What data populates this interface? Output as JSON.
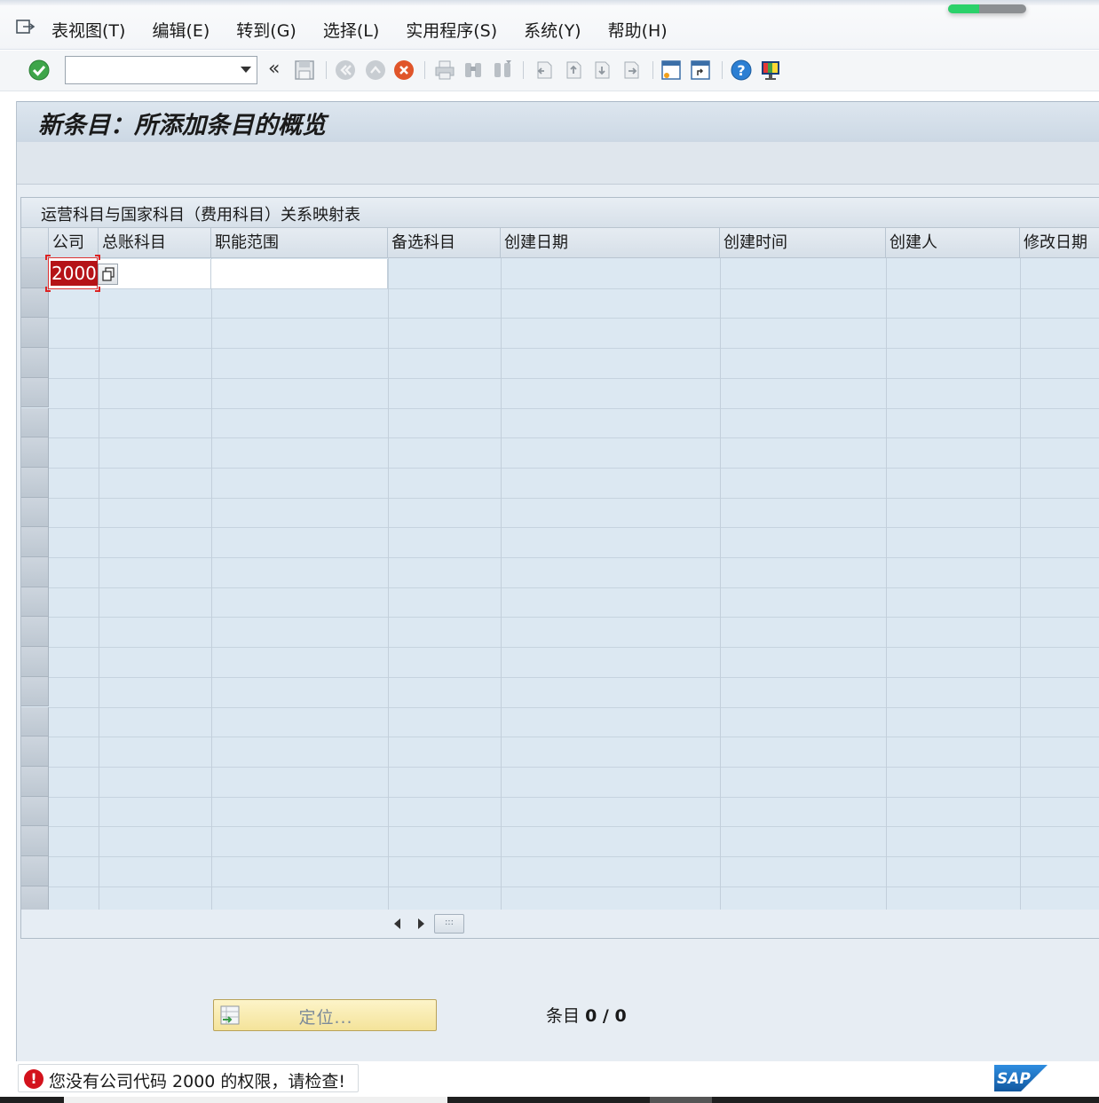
{
  "menu": {
    "items": [
      "表视图(T)",
      "编辑(E)",
      "转到(G)",
      "选择(L)",
      "实用程序(S)",
      "系统(Y)",
      "帮助(H)"
    ]
  },
  "progress": {
    "fraction": 0.4
  },
  "toolbar": {
    "command_value": "",
    "collapse_label": "«",
    "icons": [
      "check-icon",
      "save-icon",
      "back-icon",
      "exit-icon",
      "cancel-icon",
      "print-icon",
      "find-icon",
      "find-next-icon",
      "first-page-icon",
      "previous-page-icon",
      "next-page-icon",
      "last-page-icon",
      "create-session-icon",
      "shortcut-icon",
      "help-icon",
      "customize-layout-icon"
    ]
  },
  "page": {
    "title": "新条目：所添加条目的概览"
  },
  "table": {
    "title": "运营科目与国家科目（费用科目）关系映射表",
    "columns": [
      "公司",
      "总账科目",
      "职能范围",
      "备选科目",
      "创建日期",
      "创建时间",
      "创建人",
      "修改日期"
    ],
    "first_row": {
      "company": "2000"
    }
  },
  "scroll": {
    "thumb_label": ":::"
  },
  "actions": {
    "position_label": "定位..."
  },
  "entries": {
    "label": "条目",
    "value": "0 / 0"
  },
  "status": {
    "message": "您没有公司代码 2000 的权限，请检查!",
    "error_symbol": "!"
  },
  "branding": {
    "logo_text": "SAP"
  },
  "colors": {
    "accent_green": "#2bd16a",
    "error_red": "#d3121c",
    "sap_blue": "#1a6fc4"
  }
}
